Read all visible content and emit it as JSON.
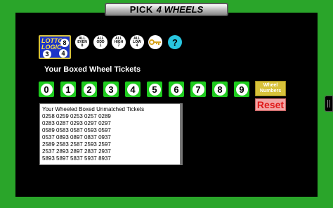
{
  "title": {
    "part1": "PICK",
    "part2": "4 WHEELS"
  },
  "logo": {
    "word1": "LOTTO",
    "word2": "LOGIC",
    "balls": [
      "8",
      "3",
      "4"
    ]
  },
  "filters": [
    {
      "line1": "ALL",
      "line2": "EVEN",
      "line3": "8"
    },
    {
      "line1": "ALL",
      "line2": "ODD",
      "line3": "1"
    },
    {
      "line1": "ALL",
      "line2": "HIGH",
      "line3": "7"
    },
    {
      "line1": "ALL",
      "line2": "LOW",
      "line3": "4"
    }
  ],
  "key_icon": "key-icon",
  "help_label": "?",
  "heading": "Your Boxed Wheel Tickets",
  "digits": [
    "0",
    "1",
    "2",
    "3",
    "4",
    "5",
    "6",
    "7",
    "8",
    "9"
  ],
  "digit_colors": {
    "selected": "#1ecb1e",
    "ball": "#ffffff",
    "dark_ball": "#000000"
  },
  "wheel_button": {
    "line1": "Wheel",
    "line2": "Numbers"
  },
  "reset_label": "Reset",
  "tickets": {
    "header": "Your Wheeled Boxed Unmatched Tickets",
    "rows": [
      "0258 0259 0253 0257 0289",
      "0283 0287 0293 0297 0297",
      "0589 0583 0587 0593 0597",
      "0537 0893 0897 0837 0937",
      "2589 2583 2587 2593 2597",
      "2537 2893 2897 2837 2937",
      "5893 5897 5837 5937 8937"
    ]
  }
}
